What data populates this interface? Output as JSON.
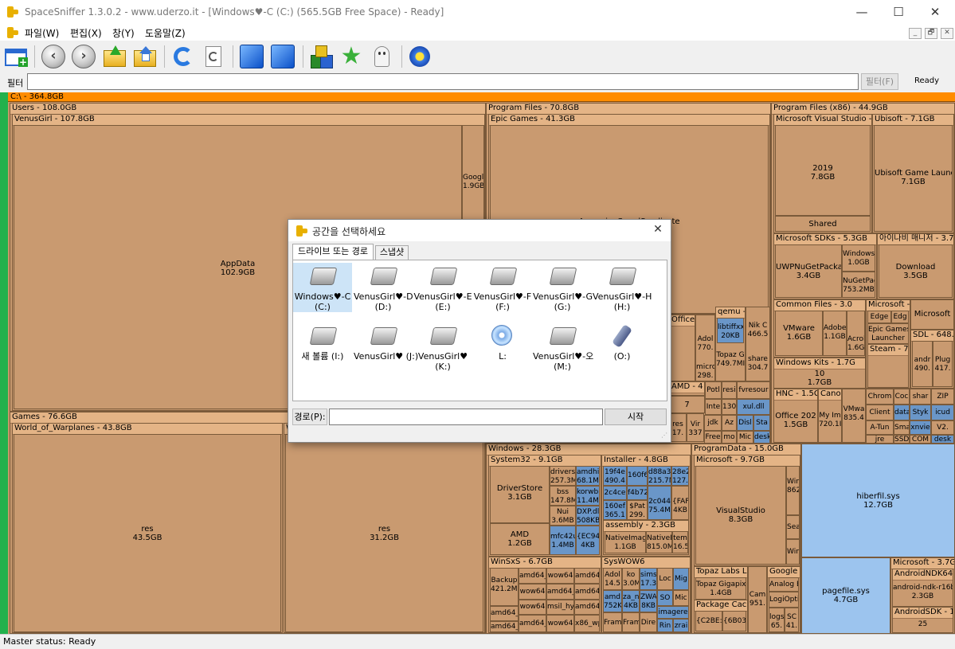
{
  "window": {
    "title": "SpaceSniffer 1.3.0.2 - www.uderzo.it - [Windows♥-C (C:) (565.5GB Free Space) - Ready]",
    "minimize": "—",
    "maximize": "☐",
    "close": "✕"
  },
  "menu": {
    "items": [
      "파일(W)",
      "편집(X)",
      "창(Y)",
      "도움말(Z)"
    ],
    "mdi": [
      "_",
      "🗗",
      "✕"
    ]
  },
  "toolbar": {
    "back": "‹",
    "forward": "›",
    "icons": [
      "new-view-icon",
      "back-icon",
      "forward-icon",
      "up-folder-icon",
      "home-folder-icon",
      "refresh-icon",
      "refresh-doc-icon",
      "zoom-in-cube-icon",
      "zoom-out-cube-icon",
      "blocks-icon",
      "star-icon",
      "ghost-icon",
      "settings-flower-icon"
    ]
  },
  "filter": {
    "label": "필터",
    "value": "",
    "button": "필터(F)",
    "status": "Ready"
  },
  "treemap": {
    "root": "C:\\ - 364.8GB",
    "users": "Users - 108.0GB",
    "venus": "VenusGirl - 107.8GB",
    "appdata": "AppData\n102.9GB",
    "googl": "Googl\n1.9GB",
    "games": "Games - 76.6GB",
    "wow": "World_of_Warplanes - 43.8GB",
    "w2": "W",
    "res1": "res\n43.5GB",
    "res2": "res\n31.2GB",
    "pf": "Program Files - 70.8GB",
    "epic": "Epic Games - 41.3GB",
    "acs": "AssassinsCreedSyndicate\n41.3GB",
    "office": "Office -",
    "adol": "Adol\n770.",
    "qemu": "qemu - S",
    "libtiff": "libtiffxx-\n20KB",
    "nik": "Nik C\n466.5",
    "micro": "micro\n298.",
    "topaz": "Topaz G\n749.7MI",
    "share": "share\n304.7",
    "amd4": "AMD - 4",
    "n7": "7",
    "potl": "Potl",
    "resi": "resi",
    "fvres": "fvresour",
    "inte": "Inte",
    "n130": "130",
    "xul": "xul.dll",
    "jdk": "jdk",
    "az": "Az",
    "disl": "Disl",
    "sta": "Sta",
    "res17": "res\n17.",
    "vir": "Vir\n337",
    "free": "Free",
    "mo": "mo",
    "mic": "Mic",
    "desk1": "desk",
    "pf86": "Program Files (x86) - 44.9GB",
    "msvs": "Microsoft Visual Studio - 9.1G",
    "y2019": "2019\n7.8GB",
    "shared": "Shared",
    "ubisoft": "Ubisoft - 7.1GB",
    "ubilaunch": "Ubisoft Game Launche\n7.1GB",
    "mssdk": "Microsoft SDKs - 5.3GB",
    "uwp": "UWPNuGetPackage\n3.4GB",
    "winsdk": "Windows I\n1.0GB",
    "nuget": "NuGetPac\n753.2MB",
    "aimani": "아이나비 매니저 - 3.7GB",
    "download": "Download\n3.5GB",
    "common": "Common Files - 3.0",
    "vmware": "VMware\n1.6GB",
    "adobe": "Adobe\n1.1GB",
    "acro": "Acrol\n1.6GB",
    "ms9": "Microsoft - 9.",
    "edge": "Edge",
    "edg": "Edg",
    "epicl": "Epic Games\nLauncher",
    "steam": "Steam - 763.",
    "microsoft": "Microsoft",
    "sdl": "SDL - 648.1",
    "andr": "andr\n490.",
    "plug": "Plug\n417.",
    "winkits": "Windows Kits - 1.7G",
    "k10": "10\n1.7GB",
    "chrom": "Chrom",
    "cod": "Coc",
    "share2": "shar",
    "zip": "ZIP",
    "hnc": "HNC - 1.5G",
    "canon": "Canon -",
    "office2": "Office 202\n1.5GB",
    "myim": "My Im\n720.1I",
    "vmwa": "VMwa\n835.4",
    "client": "Client",
    "data": "data",
    "styk": "Styk",
    "icud": "icud",
    "atun": "A-Tun",
    "sma": "Sma",
    "xnvie": "xnvie",
    "v2": "V2.",
    "jre": "jre",
    "ssd": "SSD",
    "com": "COM",
    "desk2": "desk",
    "windows": "Windows - 28.3GB",
    "sys32": "System32 - 9.1GB",
    "driverstore": "DriverStore\n3.1GB",
    "drivers": "drivers\n257.3M",
    "amdhip": "amdhip\n68.1M",
    "bss": "bss\n147.8M",
    "korwbr": "korwbr\n11.4M",
    "nui": "Nui\n3.6MB",
    "dxp": "DXP.dll\n508KB",
    "amd": "AMD\n1.2GB",
    "mfc": "mfc42u\n1.4MB",
    "ec94": "{EC94E\n4KB",
    "installer": "Installer - 4.8GB",
    "i1": "19f4e\n490.4",
    "i2": "160f6",
    "i3": "d88a3\n215.7M",
    "i4": "28e2\n127.",
    "i5": "2c4ce",
    "i6": "f4b72",
    "i7": "160ef\n365.1",
    "i8": "$Pat\n299.",
    "i9": "2c044\n75.4M",
    "i10": "{FAF\n4KB",
    "assembly": "assembly - 2.3GB",
    "nativei": "NativeImag\n1.1GB",
    "nativei2": "NativeI\n815.0MI",
    "tem": "tem\n16.5",
    "winsxs": "WinSxS - 6.7GB",
    "backup": "Backup\n421.2MI",
    "amd64": "amd64_",
    "wow64": "wow64",
    "msil": "msil_hy",
    "x86": "x86_wp",
    "syswow": "SysWOW6",
    "adol2": "Adol\n14.5",
    "ko": "ko\n3.0M",
    "sims": "sims\n17.3",
    "loc": "Loc",
    "mig": "Mig",
    "amdk": "amd\n752K",
    "zan": "za_n\n4KB",
    "zwa": "ZWA\n8KB",
    "so": "SO",
    "mic2": "Mic",
    "imagere": "imagere",
    "fram": "Fram",
    "fram2": "Fram",
    "dire": "Dire",
    "rin": "Rin",
    "zrai": "zrai",
    "progdata": "ProgramData - 15.0GB",
    "ms97": "Microsoft - 9.7GB",
    "vs": "VisualStudio\n8.3GB",
    "win862": "Win\n862",
    "sea": "Sea",
    "win2": "Win",
    "topazllc": "Topaz Labs LLC",
    "topazg": "Topaz Gigapix\n1.4GB",
    "pkgcache": "Package Cache",
    "c2be": "{C2BE:",
    "b603": "{6B03",
    "cam": "Cam\n951.",
    "google": "Google -",
    "analog": "Analog E",
    "logi": "LogiOption",
    "logs": "logs\n65.",
    "sc": "SC\n41.",
    "hiber": "hiberfil.sys\n12.7GB",
    "pagefile": "pagefile.sys\n4.7GB",
    "ms37": "Microsoft - 3.7GB",
    "ndk64": "AndroidNDK64 -",
    "ndkr": "android-ndk-r16b\n2.3GB",
    "asdk": "AndroidSDK - 1.1",
    "n25": "25"
  },
  "dialog": {
    "title": "공간을 선택하세요",
    "close": "✕",
    "tabs": [
      "드라이브 또는 경로",
      "스냅샷"
    ],
    "drives": [
      {
        "label": "Windows♥-C\n(C:)",
        "type": "hdd"
      },
      {
        "label": "VenusGirl♥-D\n(D:)",
        "type": "hdd"
      },
      {
        "label": "VenusGirl♥-E\n(E:)",
        "type": "hdd"
      },
      {
        "label": "VenusGirl♥-F\n(F:)",
        "type": "hdd"
      },
      {
        "label": "VenusGirl♥-G\n(G:)",
        "type": "hdd"
      },
      {
        "label": "VenusGirl♥-H\n(H:)",
        "type": "hdd"
      },
      {
        "label": "새 볼륨 (I:)",
        "type": "hdd"
      },
      {
        "label": "VenusGirl♥ (J:)",
        "type": "hdd"
      },
      {
        "label": "VenusGirl♥\n(K:)",
        "type": "hdd"
      },
      {
        "label": "L:",
        "type": "cd"
      },
      {
        "label": "VenusGirl♥-오\n(M:)",
        "type": "hdd"
      },
      {
        "label": "(O:)",
        "type": "usb"
      }
    ],
    "path_label": "경로(P):",
    "path_value": "",
    "start": "시작"
  },
  "status": {
    "text": "Master status: Ready"
  },
  "colors": {
    "folder": "#c99a70",
    "header": "#e4b486",
    "file": "#6a96c8",
    "root_bar": "#ff8c00",
    "side": "#22b14c"
  }
}
